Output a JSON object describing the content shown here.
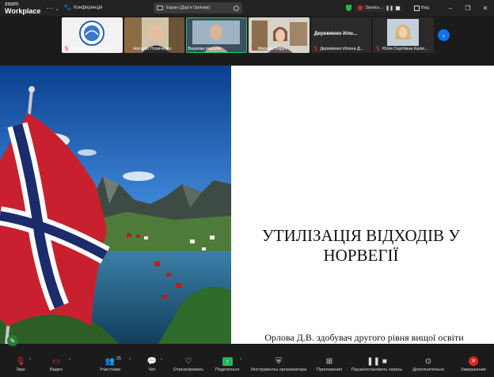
{
  "app": {
    "logo_top": "zoom",
    "logo_bottom": "Workplace"
  },
  "titlebar": {
    "conference_label": "Конференція",
    "screen_share_label": "Екран (Дар'я Орлова)",
    "recording_label": "Запись...",
    "view_label": "Вид"
  },
  "gallery": {
    "tiles": [
      {
        "name": "КАФЕДРА ЕКОЛОГІЇ",
        "muted": true
      },
      {
        "name": "Наталія Позиченко",
        "muted": true
      },
      {
        "name": "Внукова Наталія",
        "muted": false
      },
      {
        "name": "Марина Барун",
        "muted": true
      },
      {
        "name": "Деревянко Илона Д...",
        "muted": true,
        "big_name": "Деревянко Ило..."
      },
      {
        "name": "Юлія Сергіївна Калю...",
        "muted": true
      }
    ]
  },
  "slide": {
    "title_line1": "УТИЛІЗАЦІЯ ВІДХОДІВ У",
    "title_line2": "НОРВЕГІЇ",
    "author": "Орлова Д.В. здобувач другого рівня вищої освіти"
  },
  "toolbar": {
    "audio": "Звук",
    "video": "Видео",
    "participants": "Участники",
    "participants_count": "25",
    "chat": "Чат",
    "react": "Отреагировать",
    "share": "Поделиться",
    "host_tools": "Инструменты организатора",
    "apps": "Приложения",
    "pause_record": "Пауза/остановить запись",
    "more": "Дополнительно",
    "end": "Завершение"
  },
  "colors": {
    "accent_green": "#1fb65a",
    "end_red": "#e02828",
    "zoom_blue": "#0e72ed"
  }
}
